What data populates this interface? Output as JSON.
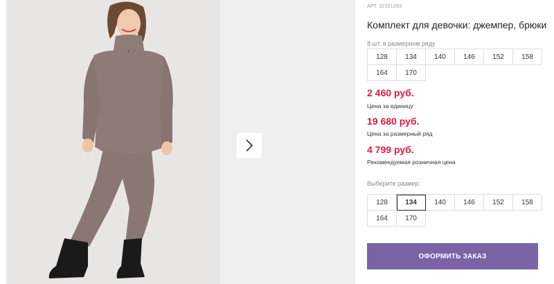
{
  "product": {
    "article_label": "АРТ.",
    "article": "32321293",
    "title": "Комплект для девочки: джемпер, брюки"
  },
  "size_row": {
    "label": "8 шт. в размерном ряду",
    "sizes": [
      "128",
      "134",
      "140",
      "146",
      "152",
      "158",
      "164",
      "170"
    ]
  },
  "prices": {
    "unit_price": "2 460 руб.",
    "unit_caption": "Цена за единицу",
    "row_price": "19 680 руб.",
    "row_caption": "Цена за размерный ряд",
    "retail_price": "4 799 руб.",
    "retail_caption": "Рекомендуемая розничная цена"
  },
  "size_select": {
    "label": "Выберите размер:",
    "sizes": [
      "128",
      "134",
      "140",
      "146",
      "152",
      "158",
      "164",
      "170"
    ],
    "selected": "134"
  },
  "order_button": "ОФОРМИТЬ ЗАКАЗ",
  "colors": {
    "price_red": "#e3193b",
    "button_purple": "#7a64a6"
  },
  "icons": {
    "gallery_next": "chevron-right-icon"
  }
}
